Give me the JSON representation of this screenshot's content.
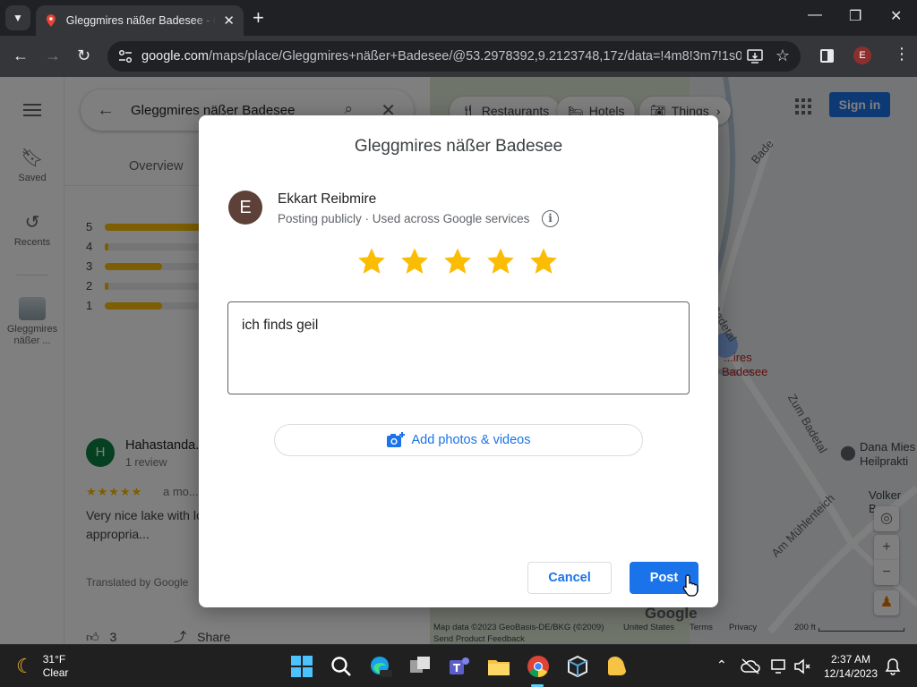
{
  "browser": {
    "tab_title": "Gleggmires näßer Badesee - Google Maps",
    "url_host": "google.com",
    "url_path": "/maps/place/Gleggmires+näßer+Badesee/@53.2978392,9.2123748,17z/data=!4m8!3m7!1s0x4...",
    "profile_initial": "E"
  },
  "rail": {
    "saved": "Saved",
    "recents": "Recents",
    "recent_place": "Gleggmires näßer ..."
  },
  "panel": {
    "search_value": "Gleggmires näßer Badesee",
    "tab_overview": "Overview",
    "histogram": [
      {
        "label": "5",
        "fraction": 0.85
      },
      {
        "label": "4",
        "fraction": 0.02
      },
      {
        "label": "3",
        "fraction": 0.32
      },
      {
        "label": "2",
        "fraction": 0.02
      },
      {
        "label": "1",
        "fraction": 0.32
      }
    ],
    "review": {
      "avatar_initial": "H",
      "author": "Hahastanda...",
      "count": "1 review",
      "stars": "★★★★★",
      "time": "a mo...",
      "text": "Very nice lake with lo... Excellent to have a n... absolutely appropria...",
      "translated": "Translated by Google",
      "likes": "3",
      "share": "Share"
    }
  },
  "map": {
    "chip_restaurants": "Restaurants",
    "chip_hotels": "Hotels",
    "chip_things": "Things",
    "sign_in": "Sign in",
    "label_bade": "Bade",
    "label_badetal": "Badetal",
    "label_place_1": "...ires",
    "label_place_2": "Badesee",
    "label_zum_badetal": "Zum Badetal",
    "label_dana_1": "Dana Mies",
    "label_dana_2": "Heilprakti",
    "label_volker": "Volker Ba",
    "label_muehlenteich": "Am Mühlenteich",
    "footer_data": "Map data ©2023 GeoBasis-DE/BKG (©2009)",
    "footer_country": "United States",
    "footer_terms": "Terms",
    "footer_privacy": "Privacy",
    "footer_feedback": "Send Product Feedback",
    "scale": "200 ft",
    "google": "Google"
  },
  "dialog": {
    "title": "Gleggmires näßer Badesee",
    "user_initial": "E",
    "user_name": "Ekkart Reibmire",
    "posting_note": "Posting publicly · Used across Google services",
    "rating": 5,
    "review_text": "ich finds geil",
    "add_photos": "Add photos & videos",
    "cancel": "Cancel",
    "post": "Post"
  },
  "taskbar": {
    "temperature": "31°F",
    "condition": "Clear",
    "time": "2:37 AM",
    "date": "12/14/2023"
  },
  "colors": {
    "accent": "#1a73e8",
    "star": "#fbbc04"
  }
}
